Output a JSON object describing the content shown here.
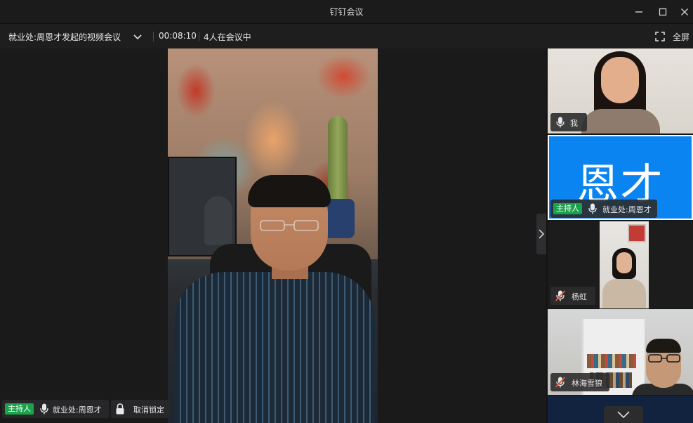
{
  "window": {
    "title": "钉钉会议",
    "controls": [
      "minimize-icon",
      "maximize-icon",
      "close-icon"
    ]
  },
  "infobar": {
    "meeting_name": "就业处:周恩才发起的视频会议",
    "elapsed": "00:08:10",
    "participant_count": "4人在会议中",
    "fullscreen_label": "全屏"
  },
  "stage": {
    "host_badge": "主持人",
    "speaker_name": "就业处:周恩才",
    "unlock_label": "取消锁定"
  },
  "participants": [
    {
      "name": "我",
      "mic": "on",
      "host": false
    },
    {
      "name": "就业处:周恩才",
      "mic": "on",
      "host": true,
      "host_badge": "主持人",
      "avatar_text": "恩才"
    },
    {
      "name": "杨虹",
      "mic": "muted",
      "host": false
    },
    {
      "name": "林海雪狼",
      "mic": "muted",
      "host": false
    }
  ],
  "colors": {
    "host_badge": "#1aa34a",
    "avatar_bg": "#0a84f0",
    "muted_mic": "#e5533b"
  }
}
